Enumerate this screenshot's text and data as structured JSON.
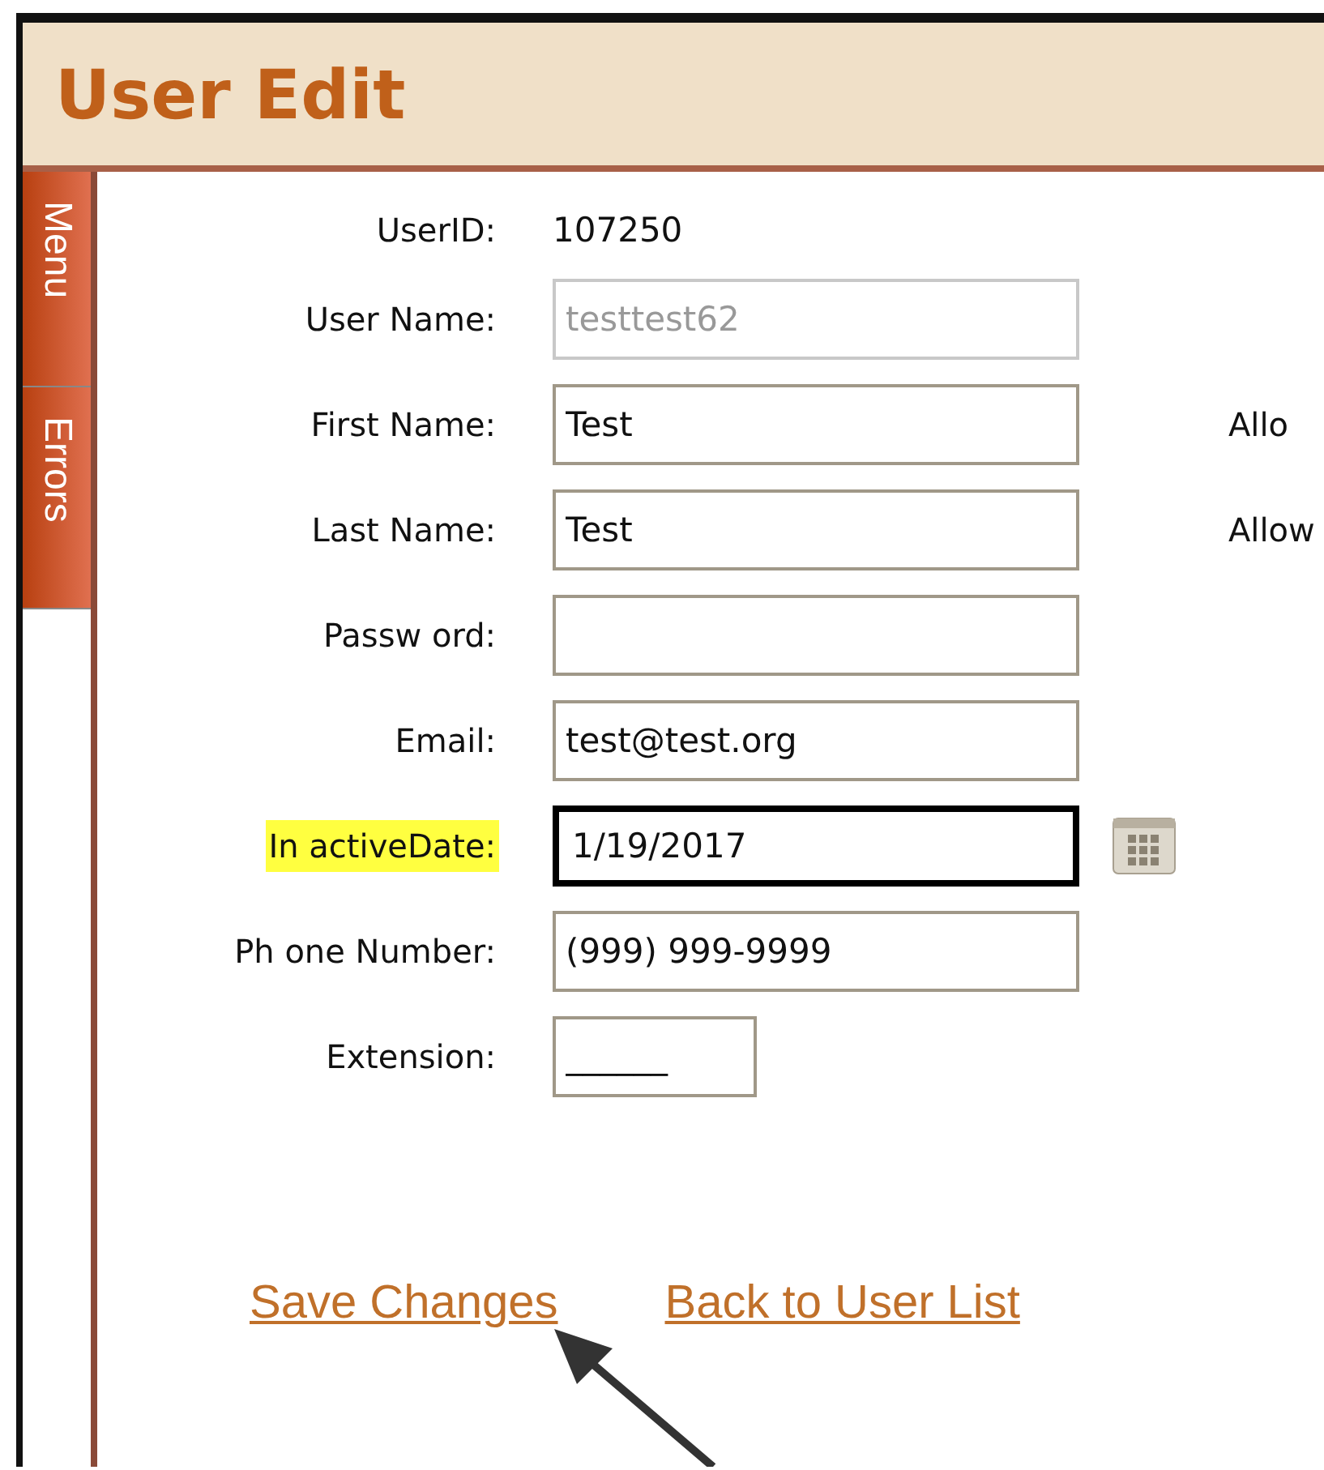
{
  "header": {
    "title": "User Edit"
  },
  "side_tabs": [
    {
      "label": "Menu"
    },
    {
      "label": "Errors"
    }
  ],
  "fields": [
    {
      "label": "UserID:",
      "kind": "static",
      "value": "107250",
      "highlighted": false
    },
    {
      "label": "User Name:",
      "kind": "text",
      "value": "testtest62",
      "disabled": true,
      "focused": false,
      "highlighted": false
    },
    {
      "label": "First Name:",
      "kind": "text",
      "value": "Test",
      "disabled": false,
      "focused": false,
      "highlighted": false,
      "side_label": "Allo"
    },
    {
      "label": "Last Name:",
      "kind": "text",
      "value": "Test",
      "disabled": false,
      "focused": false,
      "highlighted": false,
      "side_label": "Allow"
    },
    {
      "label": "Passw ord:",
      "kind": "text",
      "disabled": false,
      "focused": false,
      "highlighted": false
    },
    {
      "label": "Email:",
      "kind": "text",
      "value": "test@test.org",
      "disabled": false,
      "focused": false,
      "highlighted": false
    },
    {
      "label": "In activeDate:",
      "kind": "date",
      "value": "1/19/2017",
      "disabled": false,
      "focused": true,
      "highlighted": true
    },
    {
      "label": "Ph one Number:",
      "kind": "text",
      "value": "(999) 999-9999",
      "disabled": false,
      "focused": false,
      "highlighted": false
    },
    {
      "label": "Extension:",
      "kind": "short",
      "value": "______",
      "disabled": false,
      "focused": false,
      "highlighted": false
    }
  ],
  "links": [
    {
      "label": "Save Changes"
    },
    {
      "label": "Back to User List"
    }
  ]
}
